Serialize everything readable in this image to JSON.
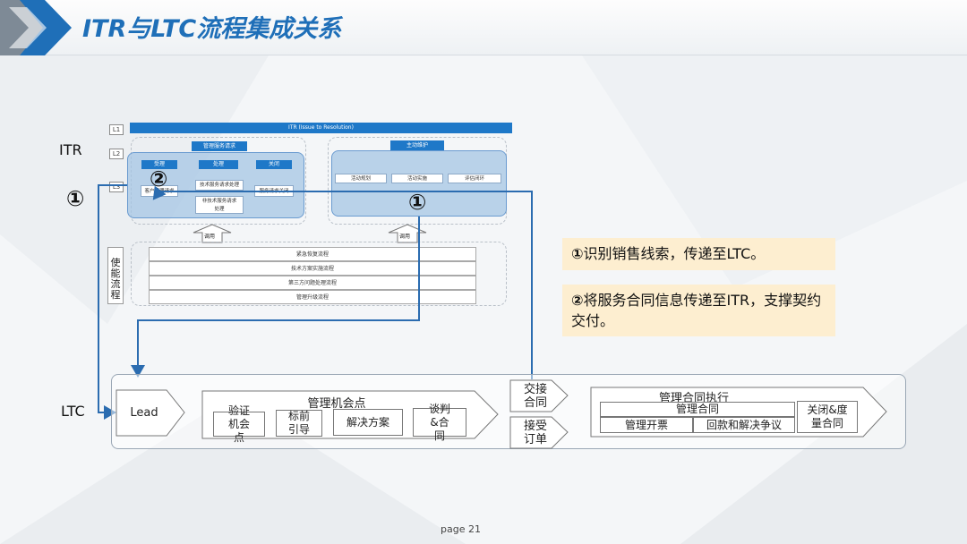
{
  "title": "ITR与LTC流程集成关系",
  "itr_side_label": "ITR",
  "ltc_side_label": "LTC",
  "marker_1": "①",
  "marker_2": "②",
  "levels": [
    "L1",
    "L2",
    "L3"
  ],
  "itr_header": "ITR (Issue to Resolution)",
  "manage_service_request": {
    "title": "管理服务请求",
    "columns": [
      {
        "head": "受理",
        "items": [
          "客户受理请求"
        ]
      },
      {
        "head": "处理",
        "items": [
          "技术服务请求处理",
          "非技术服务请求处理"
        ]
      },
      {
        "head": "关闭",
        "items": [
          "服务请求关闭"
        ]
      }
    ]
  },
  "proactive_maintenance": {
    "title": "主动维护",
    "items": [
      "活动规划",
      "活动实施",
      "评估闭环"
    ]
  },
  "call_label": "调用",
  "enabling_flows": {
    "label": "使能流程",
    "rows": [
      "紧急恢复流程",
      "技术方案实施流程",
      "第三方问题处理流程",
      "管理升级流程"
    ]
  },
  "notes": [
    {
      "marker": "①",
      "text": "识别销售线索，传递至LTC。"
    },
    {
      "marker": "②",
      "text": "将服务合同信息传递至ITR，支撑契约交付。"
    }
  ],
  "ltc": {
    "lead": "Lead",
    "manage_opportunity": {
      "title": "管理机会点",
      "items": [
        "验证机会点",
        "标前引导",
        "解决方案",
        "谈判&合同"
      ]
    },
    "handover_contract": "交接合同",
    "accept_order": "接受订单",
    "manage_contract_execution": {
      "title": "管理合同执行",
      "sub": "管理合同",
      "items": [
        "管理开票",
        "回款和解决争议"
      ],
      "close": "关闭&度量合同"
    }
  },
  "page_number": "page 21",
  "colors": {
    "title": "#1f6fb8",
    "accent_blue": "#1e78c8",
    "note_bg": "#fdeed0",
    "shade": "#a6c6e4"
  }
}
